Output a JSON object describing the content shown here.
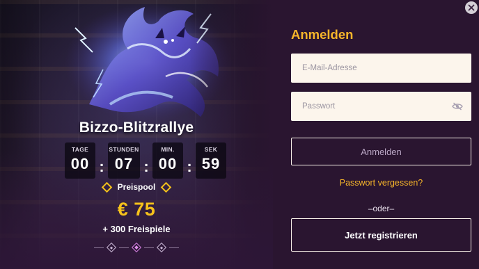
{
  "promo": {
    "title": "Bizzo-Blitzrallye",
    "countdown": [
      {
        "label": "TAGE",
        "value": "00"
      },
      {
        "label": "STUNDEN",
        "value": "07"
      },
      {
        "label": "MIN.",
        "value": "00"
      },
      {
        "label": "SEK",
        "value": "59"
      }
    ],
    "separator": ":",
    "prize_pool_label": "Preispool",
    "prize_amount": "€ 75",
    "free_spins": "+ 300 Freispiele",
    "carousel": {
      "count": 3,
      "active_index": 1
    }
  },
  "login": {
    "title": "Anmelden",
    "email_placeholder": "E-Mail-Adresse",
    "password_placeholder": "Passwort",
    "submit_label": "Anmelden",
    "forgot_label": "Passwort vergessen?",
    "divider_label": "–oder–",
    "register_label": "Jetzt registrieren"
  },
  "colors": {
    "accent_gold": "#f6b52a",
    "prize_gold": "#f6c21b",
    "panel_bg": "#2a1530",
    "field_bg": "#fcf5ec"
  },
  "icons": {
    "close": "close-icon",
    "password_toggle": "eye-slash-icon",
    "prize_ornament": "diamond-icon"
  }
}
